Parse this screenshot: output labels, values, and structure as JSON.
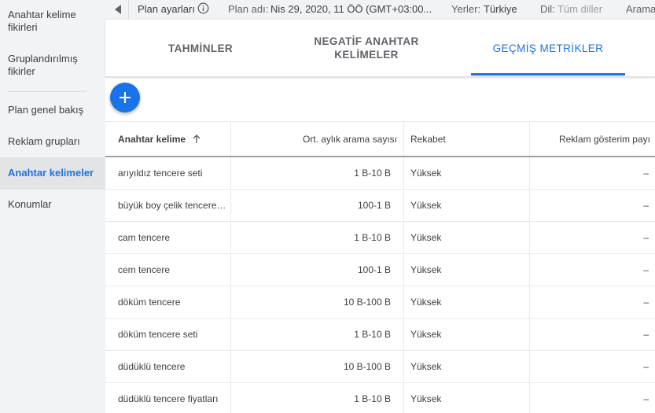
{
  "sidebar": {
    "items": [
      {
        "label": "Anahtar kelime fikirleri"
      },
      {
        "label": "Gruplandırılmış fikirler"
      },
      {
        "label": "Plan genel bakış"
      },
      {
        "label": "Reklam grupları"
      },
      {
        "label": "Anahtar kelimeler"
      },
      {
        "label": "Konumlar"
      }
    ],
    "active_index": 4
  },
  "topbar": {
    "back_icon": "chevron-left-icon",
    "plan_settings": "Plan ayarları",
    "info_icon": "info-icon",
    "plan_name_label": "Plan adı:",
    "plan_name_value": "Nis 29, 2020, 11 ÖÖ (GMT+03:00...",
    "locations_label": "Yerler:",
    "locations_value": "Türkiye",
    "language_label": "Dil:",
    "language_value": "Tüm diller",
    "search_label": "Arama"
  },
  "tabs": [
    {
      "label": "TAHMİNLER"
    },
    {
      "label": "NEGATİF ANAHTAR KELİMELER"
    },
    {
      "label": "GEÇMİŞ METRİKLER"
    }
  ],
  "active_tab": 2,
  "fab": {
    "icon": "plus-icon"
  },
  "table": {
    "headers": [
      "Anahtar kelime",
      "Ort. aylık arama sayısı",
      "Rekabet",
      "Reklam gösterim payı"
    ],
    "sort_icon": "arrow-up-icon",
    "rows": [
      {
        "keyword": "arıyıldız tencere seti",
        "searches": "1 B-10 B",
        "competition": "Yüksek",
        "share": "–"
      },
      {
        "keyword": "büyük boy çelik tencere…",
        "searches": "100-1 B",
        "competition": "Yüksek",
        "share": "–"
      },
      {
        "keyword": "cam tencere",
        "searches": "1 B-10 B",
        "competition": "Yüksek",
        "share": "–"
      },
      {
        "keyword": "cem tencere",
        "searches": "100-1 B",
        "competition": "Yüksek",
        "share": "–"
      },
      {
        "keyword": "döküm tencere",
        "searches": "10 B-100 B",
        "competition": "Yüksek",
        "share": "–"
      },
      {
        "keyword": "döküm tencere seti",
        "searches": "1 B-10 B",
        "competition": "Yüksek",
        "share": "–"
      },
      {
        "keyword": "düdüklü tencere",
        "searches": "10 B-100 B",
        "competition": "Yüksek",
        "share": "–"
      },
      {
        "keyword": "düdüklü tencere fiyatları",
        "searches": "1 B-10 B",
        "competition": "Yüksek",
        "share": "–"
      }
    ]
  },
  "colors": {
    "accent": "#1a73e8",
    "sidebar_bg": "#f1f3f4",
    "active_item_bg": "#e3e4e6"
  }
}
